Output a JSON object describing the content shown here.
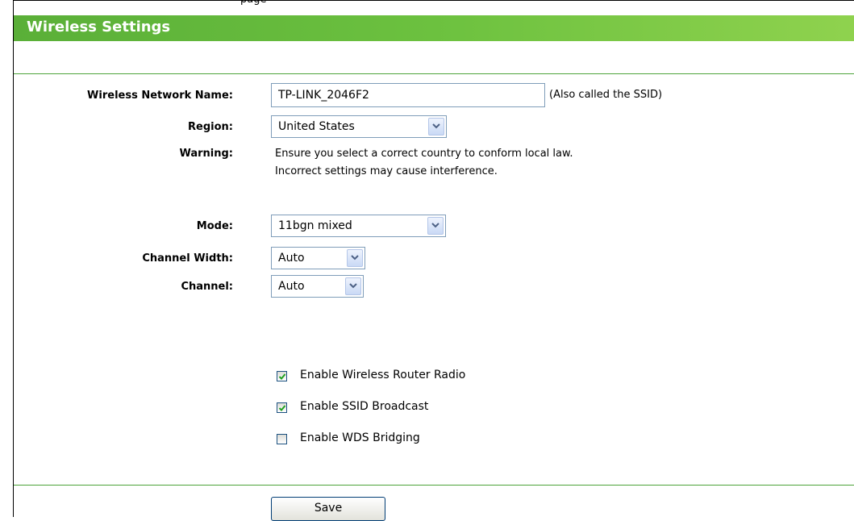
{
  "top_caption": "page",
  "header": {
    "title": "Wireless Settings"
  },
  "fields": {
    "ssid": {
      "label": "Wireless Network Name:",
      "value": "TP-LINK_2046F2",
      "hint": "(Also called the SSID)"
    },
    "region": {
      "label": "Region:",
      "value": "United States"
    },
    "warning": {
      "label": "Warning:",
      "line1": "Ensure you select a correct country to conform local law.",
      "line2": "Incorrect settings may cause interference."
    },
    "mode": {
      "label": "Mode:",
      "value": "11bgn mixed"
    },
    "channel_width": {
      "label": "Channel Width:",
      "value": "Auto"
    },
    "channel": {
      "label": "Channel:",
      "value": "Auto"
    }
  },
  "checkboxes": [
    {
      "label": "Enable Wireless Router Radio",
      "checked": true
    },
    {
      "label": "Enable SSID Broadcast",
      "checked": true
    },
    {
      "label": "Enable WDS Bridging",
      "checked": false
    }
  ],
  "save_label": "Save",
  "colors": {
    "header_green": "#6cc13f",
    "rule_green": "#4ea33a",
    "check_green": "#21a121"
  }
}
